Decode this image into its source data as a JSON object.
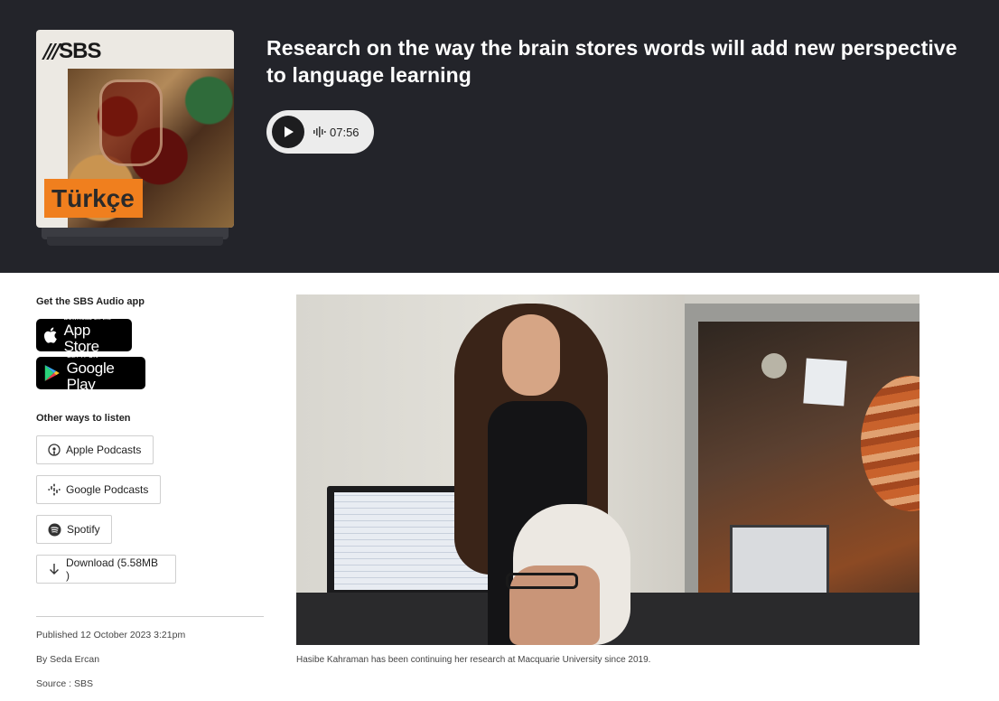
{
  "episode": {
    "cover": {
      "brand_text": "SBS",
      "tag": "Türkçe"
    },
    "title": "Research on the way the brain stores words will add new perspective to language learning",
    "player": {
      "duration": "07:56"
    }
  },
  "sidebar": {
    "app_heading": "Get the SBS Audio app",
    "app_store": {
      "small": "Download on the",
      "big": "App Store"
    },
    "google_play": {
      "small": "GET IT ON",
      "big": "Google Play"
    },
    "listen_heading": "Other ways to listen",
    "listen_options": [
      {
        "label": "Apple Podcasts",
        "icon": "apple-podcasts-icon"
      },
      {
        "label": "Google Podcasts",
        "icon": "google-podcasts-icon"
      },
      {
        "label": "Spotify",
        "icon": "spotify-icon"
      },
      {
        "label": "Download (5.58MB )",
        "icon": "download-icon"
      }
    ],
    "published": "Published 12 October 2023 3:21pm",
    "author": "By Seda Ercan",
    "source": "Source : SBS"
  },
  "article": {
    "caption": "Hasibe Kahraman has been continuing her research at Macquarie University since 2019."
  },
  "colors": {
    "hero_bg": "#23242a",
    "tag_orange": "#f07f1e"
  }
}
